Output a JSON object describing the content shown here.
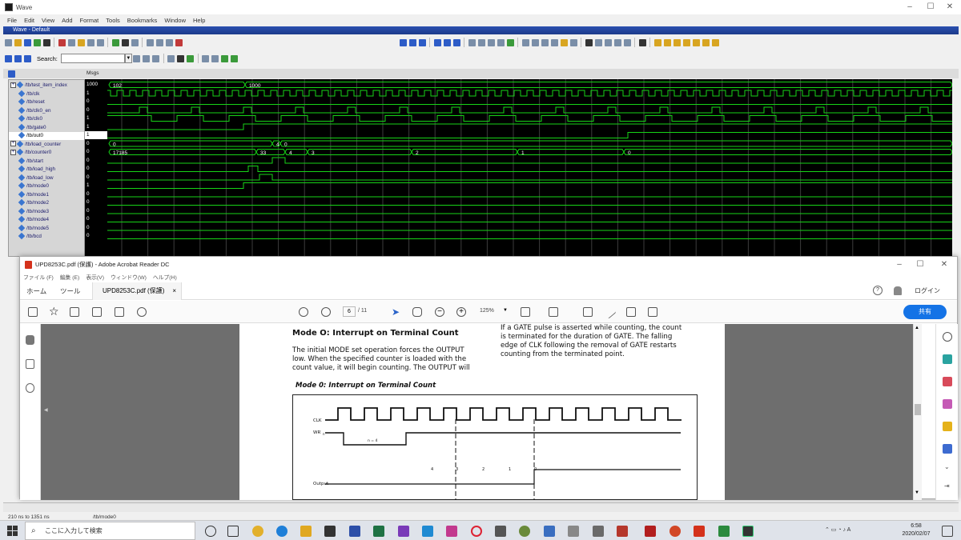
{
  "wave": {
    "window_title": "Wave",
    "menu": [
      "File",
      "Edit",
      "View",
      "Add",
      "Format",
      "Tools",
      "Bookmarks",
      "Window",
      "Help"
    ],
    "inner_title": "Wave - Default",
    "search_label": "Search:",
    "msgs_header": "Msgs",
    "signals": [
      {
        "name": "/tb/test_item_index",
        "value": "1000",
        "expand": "+",
        "kind": "bus"
      },
      {
        "name": "/tb/clk",
        "value": "1",
        "kind": "bit"
      },
      {
        "name": "/tb/reset",
        "value": "0",
        "kind": "bit"
      },
      {
        "name": "/tb/clk0_en",
        "value": "0",
        "kind": "bit"
      },
      {
        "name": "/tb/clk0",
        "value": "1",
        "kind": "bit"
      },
      {
        "name": "/tb/gate0",
        "value": "1",
        "kind": "bit"
      },
      {
        "name": "/tb/out0",
        "value": "1",
        "kind": "bit",
        "selected": true
      },
      {
        "name": "/tb/load_counter",
        "value": "0",
        "expand": "+",
        "kind": "bus"
      },
      {
        "name": "/tb/counter0",
        "value": "0",
        "expand": "+",
        "kind": "bus"
      },
      {
        "name": "/tb/start",
        "value": "0",
        "kind": "bit"
      },
      {
        "name": "/tb/load_high",
        "value": "0",
        "kind": "bit"
      },
      {
        "name": "/tb/load_low",
        "value": "0",
        "kind": "bit"
      },
      {
        "name": "/tb/mode0",
        "value": "1",
        "kind": "bit"
      },
      {
        "name": "/tb/mode1",
        "value": "0",
        "kind": "bit"
      },
      {
        "name": "/tb/mode2",
        "value": "0",
        "kind": "bit"
      },
      {
        "name": "/tb/mode3",
        "value": "0",
        "kind": "bit"
      },
      {
        "name": "/tb/mode4",
        "value": "0",
        "kind": "bit"
      },
      {
        "name": "/tb/mode5",
        "value": "0",
        "kind": "bit"
      },
      {
        "name": "/tb/bcd",
        "value": "0",
        "kind": "bit"
      }
    ],
    "bus_labels": {
      "test_item_index": [
        "102",
        "1000"
      ],
      "load_counter": [
        "0",
        "4",
        "0"
      ],
      "counter0": [
        "17185",
        "33",
        "4",
        "3",
        "2",
        "1",
        "0"
      ]
    },
    "status_left": "210 ns to 1351 ns",
    "status_right": "/tb/mode0"
  },
  "acrobat": {
    "title": "UPD8253C.pdf (保護) - Adobe Acrobat Reader DC",
    "menu": [
      "ファイル (F)",
      "編集 (E)",
      "表示(V)",
      "ウィンドウ(W)",
      "ヘルプ(H)"
    ],
    "tab_home": "ホーム",
    "tab_tools": "ツール",
    "tab_doc": "UPD8253C.pdf (保護)",
    "tab_close": "×",
    "login": "ログイン",
    "share": "共有",
    "page_current": "6",
    "page_total": "/ 11",
    "zoom": "125%",
    "doc": {
      "heading": "Mode O: Interrupt on Terminal Count",
      "left_para": [
        "The initial MODE set operation forces the OUTPUT",
        "low. When the specified counter is loaded with the",
        "count value, it will begin counting. The OUTPUT will"
      ],
      "right_para": [
        "If a GATE pulse is asserted while counting, the count",
        "is terminated for the duration of GATE. The falling",
        "edge of CLK following the removal of GATE restarts",
        "counting from the terminated point."
      ],
      "figure_caption": "Mode 0: Interrupt on Terminal Count",
      "fig_labels": {
        "clk": "CLK",
        "wr": "WR",
        "wr_sub": "n",
        "n_eq": "n = 4",
        "output": "Output",
        "counts": [
          "4",
          "3",
          "2",
          "1",
          "0"
        ]
      }
    }
  },
  "taskbar": {
    "search_placeholder": "ここに入力して検索",
    "time": "6:58",
    "date": "2020/02/07",
    "tray_lang": "A"
  },
  "colors": {
    "wave_green": "#17d417",
    "wave_bg": "#000000",
    "wave_grid": "#3c3c3c",
    "acrobat_blue": "#1473e6",
    "acrobat_red": "#d4311b"
  }
}
